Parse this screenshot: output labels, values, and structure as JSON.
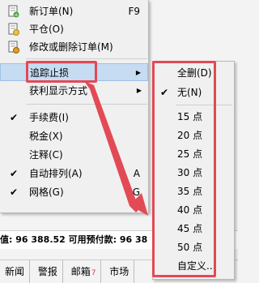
{
  "menu": {
    "items": [
      {
        "label": "新订单(N)",
        "accel": "F9",
        "icon": "new-order-icon"
      },
      {
        "label": "平仓(O)",
        "icon": "close-position-icon"
      },
      {
        "label": "修改或删除订单(M)",
        "icon": "modify-order-icon"
      },
      {
        "label": "追踪止损",
        "submenu_arrow": "▶"
      },
      {
        "label": "获利显示方式",
        "submenu_arrow": "▶"
      },
      {
        "label": "手续费(I)",
        "checked": true
      },
      {
        "label": "税金(X)"
      },
      {
        "label": "注释(C)"
      },
      {
        "label": "自动排列(A)",
        "accel": "A",
        "checked": true
      },
      {
        "label": "网格(G)",
        "accel": "G",
        "checked": true
      }
    ]
  },
  "submenu": {
    "items": [
      {
        "label": "全删(D)"
      },
      {
        "label": "无(N)",
        "checked": true
      },
      {
        "label": "15 点"
      },
      {
        "label": "20 点"
      },
      {
        "label": "25 点"
      },
      {
        "label": "30 点"
      },
      {
        "label": "35 点"
      },
      {
        "label": "40 点"
      },
      {
        "label": "45 点"
      },
      {
        "label": "50 点"
      },
      {
        "label": "自定义..."
      }
    ]
  },
  "status": {
    "text": "值: 96 388.52  可用预付款: 96 38"
  },
  "tabs": [
    {
      "label": "新闻"
    },
    {
      "label": "警报"
    },
    {
      "label": "邮箱",
      "badge": "7"
    },
    {
      "label": "市场"
    }
  ],
  "colors": {
    "highlight": "#c6dcf3",
    "annotation_red": "#e24a55"
  },
  "checkmark": "✔"
}
